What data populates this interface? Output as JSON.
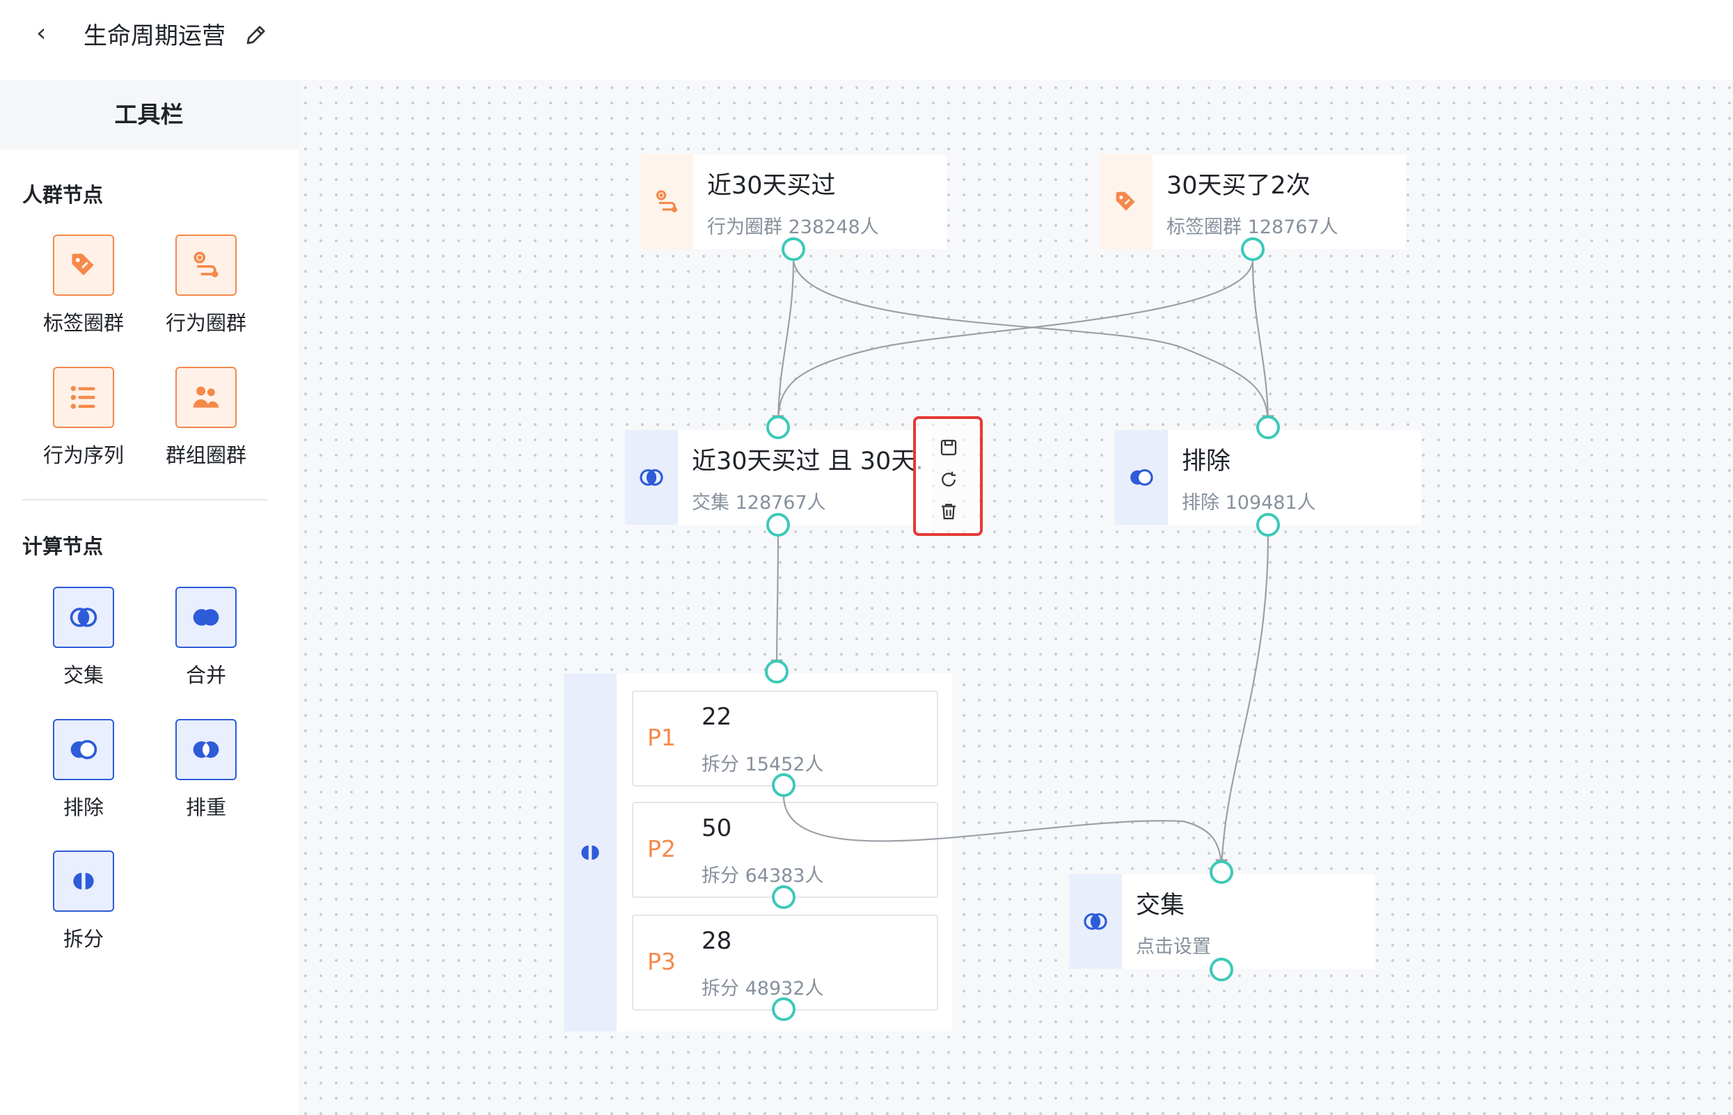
{
  "header": {
    "back_glyph": "‹",
    "title": "生命周期运营"
  },
  "sidebar": {
    "title": "工具栏",
    "crowd_section": "人群节点",
    "calc_section": "计算节点",
    "crowd_tools": [
      {
        "label": "标签圈群",
        "icon": "tag-icon"
      },
      {
        "label": "行为圈群",
        "icon": "user-path-icon"
      },
      {
        "label": "行为序列",
        "icon": "list-icon"
      },
      {
        "label": "群组圈群",
        "icon": "group-icon"
      }
    ],
    "calc_tools": [
      {
        "label": "交集",
        "icon": "intersect-icon"
      },
      {
        "label": "合并",
        "icon": "union-icon"
      },
      {
        "label": "排除",
        "icon": "exclude-icon"
      },
      {
        "label": "排重",
        "icon": "dedupe-icon"
      },
      {
        "label": "拆分",
        "icon": "split-icon"
      }
    ]
  },
  "nodes": {
    "n1": {
      "title": "近30天买过",
      "sub": "行为圈群 238248人"
    },
    "n2": {
      "title": "30天买了2次",
      "sub": "标签圈群 128767人"
    },
    "n3": {
      "title": "近30天买过 且 30天..",
      "sub": "交集 128767人"
    },
    "n4": {
      "title": "排除",
      "sub": "排除 109481人"
    },
    "n5": {
      "title": "交集",
      "sub": "点击设置"
    }
  },
  "split": {
    "items": [
      {
        "tag": "P1",
        "value": "22",
        "sub": "拆分 15452人"
      },
      {
        "tag": "P2",
        "value": "50",
        "sub": "拆分 64383人"
      },
      {
        "tag": "P3",
        "value": "28",
        "sub": "拆分 48932人"
      }
    ]
  },
  "colors": {
    "accent_orange": "#f5894a",
    "accent_blue": "#2e5bd8",
    "port": "#3cc9b9",
    "highlight": "#e53935"
  }
}
